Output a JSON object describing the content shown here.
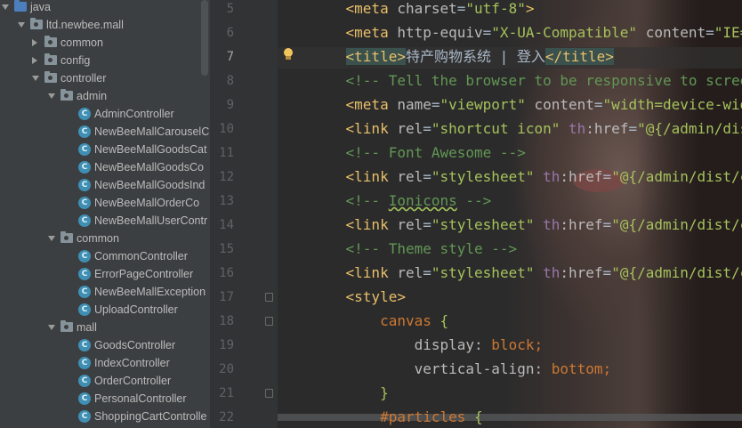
{
  "tree": {
    "items": [
      {
        "label": "java",
        "depth": 0,
        "kind": "src-folder",
        "expanded": true
      },
      {
        "label": "ltd.newbee.mall",
        "depth": 1,
        "kind": "package",
        "expanded": true
      },
      {
        "label": "common",
        "depth": 2,
        "kind": "package",
        "expanded": false
      },
      {
        "label": "config",
        "depth": 2,
        "kind": "package",
        "expanded": false
      },
      {
        "label": "controller",
        "depth": 2,
        "kind": "package",
        "expanded": true
      },
      {
        "label": "admin",
        "depth": 3,
        "kind": "package",
        "expanded": true
      },
      {
        "label": "AdminController",
        "depth": 4,
        "kind": "class"
      },
      {
        "label": "NewBeeMallCarouselC",
        "depth": 4,
        "kind": "class"
      },
      {
        "label": "NewBeeMallGoodsCat",
        "depth": 4,
        "kind": "class"
      },
      {
        "label": "NewBeeMallGoodsCo",
        "depth": 4,
        "kind": "class"
      },
      {
        "label": "NewBeeMallGoodsInd",
        "depth": 4,
        "kind": "class"
      },
      {
        "label": "NewBeeMallOrderCo",
        "depth": 4,
        "kind": "class"
      },
      {
        "label": "NewBeeMallUserContr",
        "depth": 4,
        "kind": "class"
      },
      {
        "label": "common",
        "depth": 3,
        "kind": "package",
        "expanded": true
      },
      {
        "label": "CommonController",
        "depth": 4,
        "kind": "class"
      },
      {
        "label": "ErrorPageController",
        "depth": 4,
        "kind": "class"
      },
      {
        "label": "NewBeeMallException",
        "depth": 4,
        "kind": "class"
      },
      {
        "label": "UploadController",
        "depth": 4,
        "kind": "class"
      },
      {
        "label": "mall",
        "depth": 3,
        "kind": "package",
        "expanded": true
      },
      {
        "label": "GoodsController",
        "depth": 4,
        "kind": "class"
      },
      {
        "label": "IndexController",
        "depth": 4,
        "kind": "class"
      },
      {
        "label": "OrderController",
        "depth": 4,
        "kind": "class"
      },
      {
        "label": "PersonalController",
        "depth": 4,
        "kind": "class"
      },
      {
        "label": "ShoppingCartControlle",
        "depth": 4,
        "kind": "class"
      }
    ],
    "class_icon_letter": "C"
  },
  "editor": {
    "current_line": 7,
    "lines": [
      {
        "num": "5",
        "tokens": [
          [
            "    ",
            "txt"
          ],
          [
            "<meta ",
            "tag"
          ],
          [
            "charset",
            "attr"
          ],
          [
            "=",
            "txt"
          ],
          [
            "\"utf-8\"",
            "val"
          ],
          [
            ">",
            "tag"
          ]
        ]
      },
      {
        "num": "6",
        "tokens": [
          [
            "    ",
            "txt"
          ],
          [
            "<meta ",
            "tag"
          ],
          [
            "http-equiv",
            "attr"
          ],
          [
            "=",
            "txt"
          ],
          [
            "\"X-UA-Compatible\"",
            "val"
          ],
          [
            " ",
            "txt"
          ],
          [
            "content",
            "attr"
          ],
          [
            "=",
            "txt"
          ],
          [
            "\"IE=ed",
            "val"
          ]
        ]
      },
      {
        "num": "7",
        "tokens": [
          [
            "    ",
            "txt"
          ],
          [
            "<title>",
            "tagbox"
          ],
          [
            "特产购物系统 | 登入",
            "txt"
          ],
          [
            "</title>",
            "tagbox"
          ]
        ]
      },
      {
        "num": "8",
        "tokens": [
          [
            "    ",
            "txt"
          ],
          [
            "<!-- Tell the browser to be responsive to screen",
            "cmt"
          ]
        ]
      },
      {
        "num": "9",
        "tokens": [
          [
            "    ",
            "txt"
          ],
          [
            "<meta ",
            "tag"
          ],
          [
            "name",
            "attr"
          ],
          [
            "=",
            "txt"
          ],
          [
            "\"viewport\"",
            "val"
          ],
          [
            " ",
            "txt"
          ],
          [
            "content",
            "attr"
          ],
          [
            "=",
            "txt"
          ],
          [
            "\"width=device-width",
            "val"
          ]
        ]
      },
      {
        "num": "10",
        "tokens": [
          [
            "    ",
            "txt"
          ],
          [
            "<link ",
            "tag"
          ],
          [
            "rel",
            "attr"
          ],
          [
            "=",
            "txt"
          ],
          [
            "\"shortcut icon\"",
            "val"
          ],
          [
            " ",
            "txt"
          ],
          [
            "th",
            "ns"
          ],
          [
            ":href",
            "attr"
          ],
          [
            "=",
            "txt"
          ],
          [
            "\"@{/admin/dist/",
            "val"
          ]
        ]
      },
      {
        "num": "11",
        "tokens": [
          [
            "    ",
            "txt"
          ],
          [
            "<!-- Font Awesome -->",
            "cmt"
          ]
        ]
      },
      {
        "num": "12",
        "tokens": [
          [
            "    ",
            "txt"
          ],
          [
            "<link ",
            "tag"
          ],
          [
            "rel",
            "attr"
          ],
          [
            "=",
            "txt"
          ],
          [
            "\"stylesheet\"",
            "val"
          ],
          [
            " ",
            "txt"
          ],
          [
            "th",
            "ns"
          ],
          [
            ":href",
            "attr"
          ],
          [
            "=",
            "txt"
          ],
          [
            "\"@{/admin/dist/css",
            "val"
          ]
        ]
      },
      {
        "num": "13",
        "tokens": [
          [
            "    ",
            "txt"
          ],
          [
            "<!-- ",
            "cmt"
          ],
          [
            "Ionicons",
            "cmtwave"
          ],
          [
            " -->",
            "cmt"
          ]
        ]
      },
      {
        "num": "14",
        "tokens": [
          [
            "    ",
            "txt"
          ],
          [
            "<link ",
            "tag"
          ],
          [
            "rel",
            "attr"
          ],
          [
            "=",
            "txt"
          ],
          [
            "\"stylesheet\"",
            "val"
          ],
          [
            " ",
            "txt"
          ],
          [
            "th",
            "ns"
          ],
          [
            ":href",
            "attr"
          ],
          [
            "=",
            "txt"
          ],
          [
            "\"@{/admin/dist/css",
            "val"
          ]
        ]
      },
      {
        "num": "15",
        "tokens": [
          [
            "    ",
            "txt"
          ],
          [
            "<!-- Theme style -->",
            "cmt"
          ]
        ]
      },
      {
        "num": "16",
        "tokens": [
          [
            "    ",
            "txt"
          ],
          [
            "<link ",
            "tag"
          ],
          [
            "rel",
            "attr"
          ],
          [
            "=",
            "txt"
          ],
          [
            "\"stylesheet\"",
            "val"
          ],
          [
            " ",
            "txt"
          ],
          [
            "th",
            "ns"
          ],
          [
            ":href",
            "attr"
          ],
          [
            "=",
            "txt"
          ],
          [
            "\"@{/admin/dist/css",
            "val"
          ]
        ]
      },
      {
        "num": "17",
        "tokens": [
          [
            "    ",
            "txt"
          ],
          [
            "<style>",
            "tag"
          ]
        ]
      },
      {
        "num": "18",
        "tokens": [
          [
            "        ",
            "txt"
          ],
          [
            "canvas",
            "el"
          ],
          [
            " {",
            "val"
          ]
        ]
      },
      {
        "num": "19",
        "tokens": [
          [
            "            ",
            "txt"
          ],
          [
            "display",
            "attr"
          ],
          [
            ": ",
            "txt"
          ],
          [
            "block",
            "el"
          ],
          [
            ";",
            "el"
          ]
        ]
      },
      {
        "num": "20",
        "tokens": [
          [
            "            ",
            "txt"
          ],
          [
            "vertical-align",
            "attr"
          ],
          [
            ": ",
            "txt"
          ],
          [
            "bottom",
            "el"
          ],
          [
            ";",
            "el"
          ]
        ]
      },
      {
        "num": "21",
        "tokens": [
          [
            "        ",
            "txt"
          ],
          [
            "}",
            "val"
          ]
        ]
      },
      {
        "num": "22",
        "tokens": [
          [
            "        ",
            "txt"
          ],
          [
            "#particles",
            "el"
          ],
          [
            " {",
            "val"
          ]
        ]
      }
    ]
  },
  "colors": {
    "tree_bg": "#3c3f41",
    "editor_bg": "#2b2b2b",
    "tag": "#e8bf6a",
    "string": "#a5c25c",
    "comment": "#629755",
    "keyword": "#cc7832"
  }
}
